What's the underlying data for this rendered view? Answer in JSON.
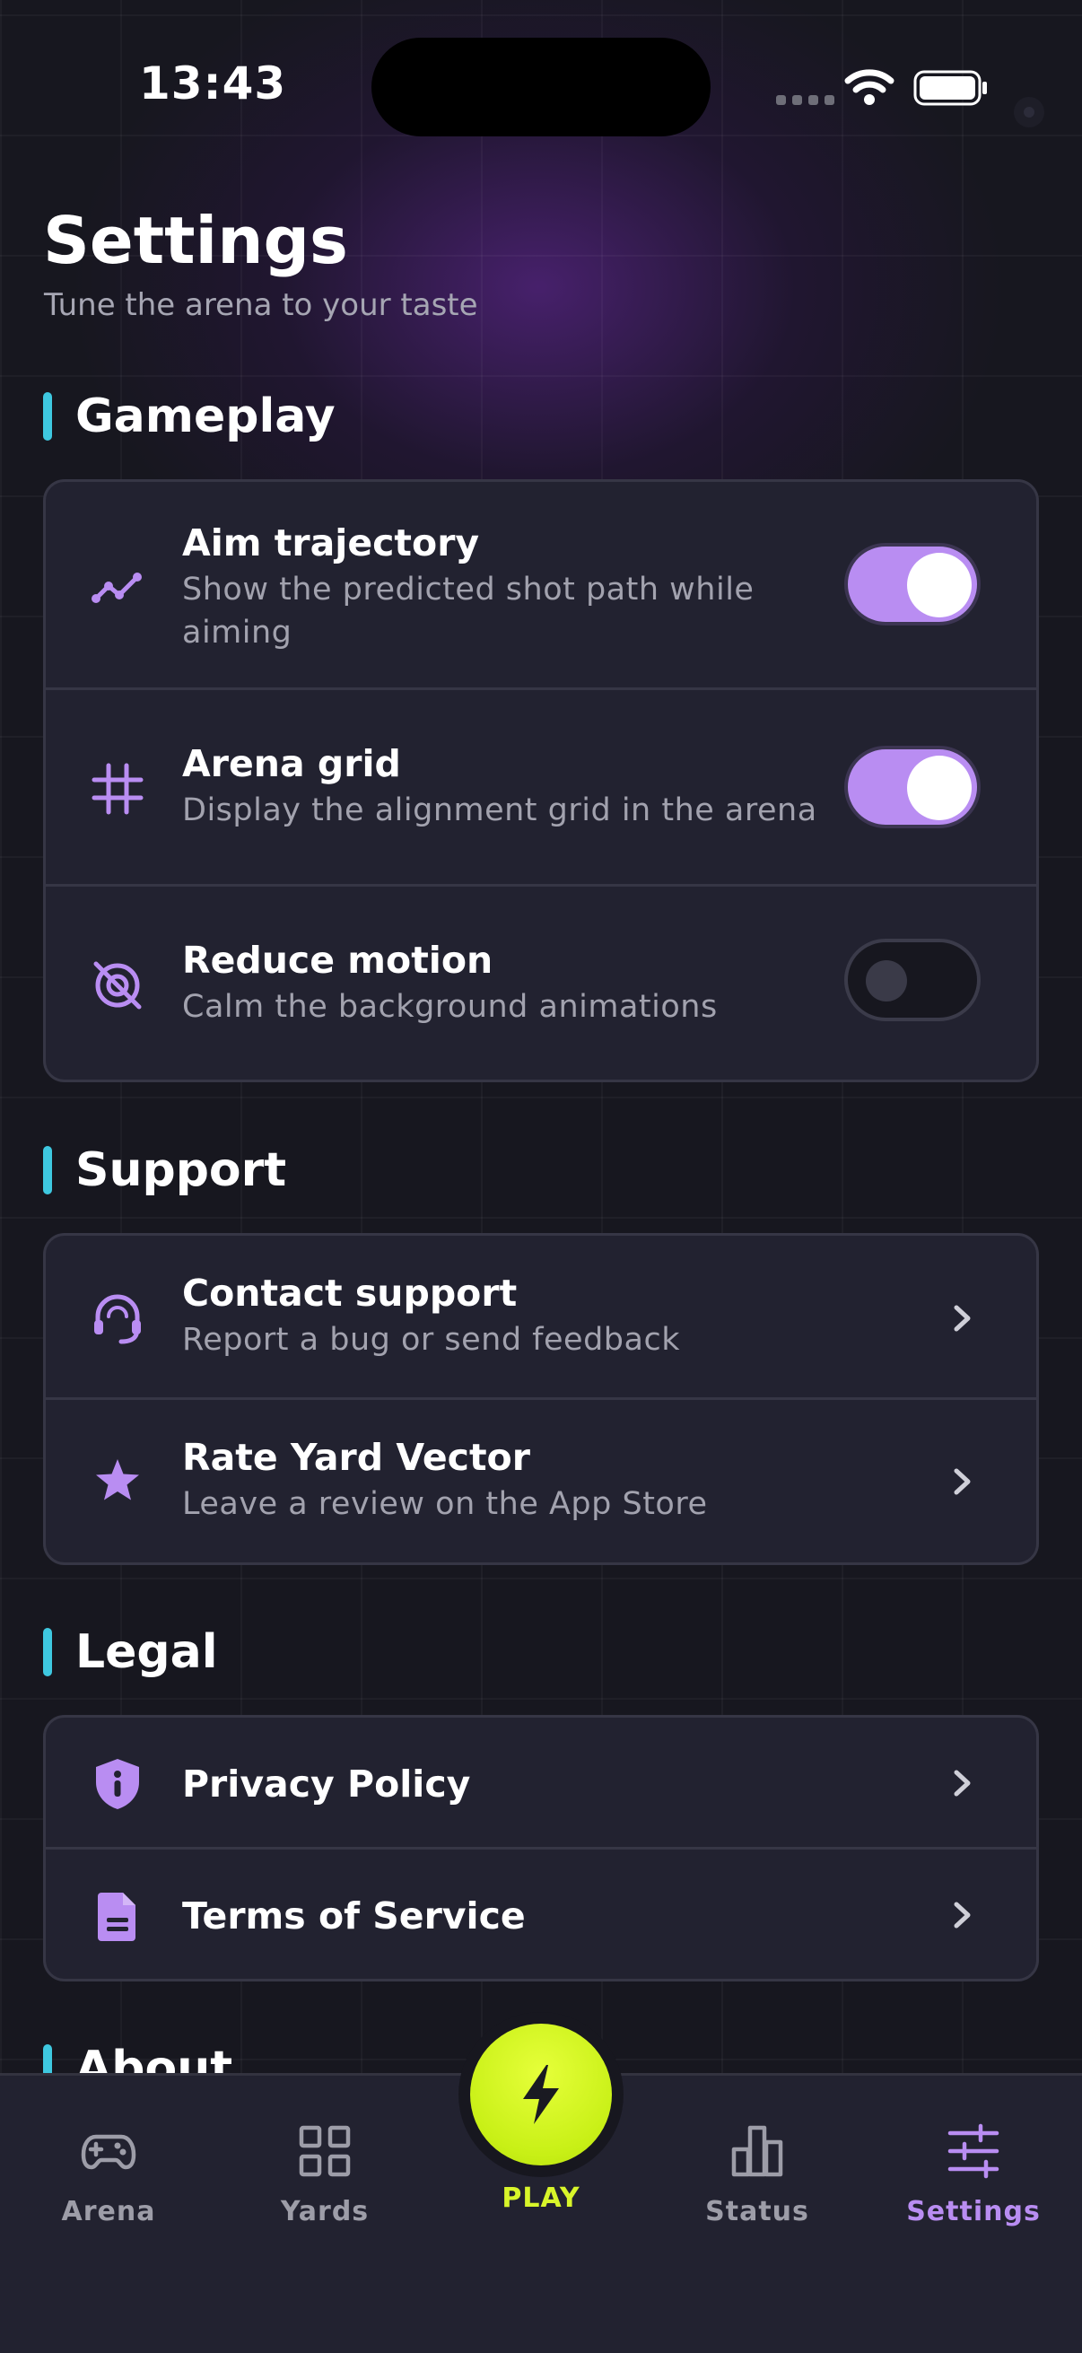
{
  "status_bar": {
    "time": "13:43"
  },
  "header": {
    "title": "Settings",
    "subtitle": "Tune the arena to your taste"
  },
  "sections": {
    "gameplay": {
      "label": "Gameplay",
      "items": [
        {
          "title": "Aim trajectory",
          "desc_line1": "Show the predicted shot path while",
          "desc_line2": "aiming",
          "icon": "trajectory-icon",
          "toggle_on": true
        },
        {
          "title": "Arena grid",
          "desc": "Display the alignment grid in the arena",
          "icon": "grid-icon",
          "toggle_on": true
        },
        {
          "title": "Reduce motion",
          "desc": "Calm the background animations",
          "icon": "motion-off-icon",
          "toggle_on": false
        }
      ]
    },
    "support": {
      "label": "Support",
      "items": [
        {
          "title": "Contact support",
          "desc": "Report a bug or send feedback",
          "icon": "headset-icon"
        },
        {
          "title": "Rate Yard Vector",
          "desc": "Leave a review on the App Store",
          "icon": "star-icon"
        }
      ]
    },
    "legal": {
      "label": "Legal",
      "items": [
        {
          "title": "Privacy Policy",
          "icon": "shield-info-icon"
        },
        {
          "title": "Terms of Service",
          "icon": "document-icon"
        }
      ]
    },
    "about": {
      "label": "About"
    }
  },
  "tabbar": {
    "arena": "Arena",
    "yards": "Yards",
    "play": "PLAY",
    "status": "Status",
    "settings": "Settings",
    "active": "settings"
  },
  "colors": {
    "background": "#17171f",
    "card": "#222230",
    "accent_purple": "#b98df2",
    "accent_cyan": "#3ec8e0",
    "play_lime": "#d8f52a"
  }
}
